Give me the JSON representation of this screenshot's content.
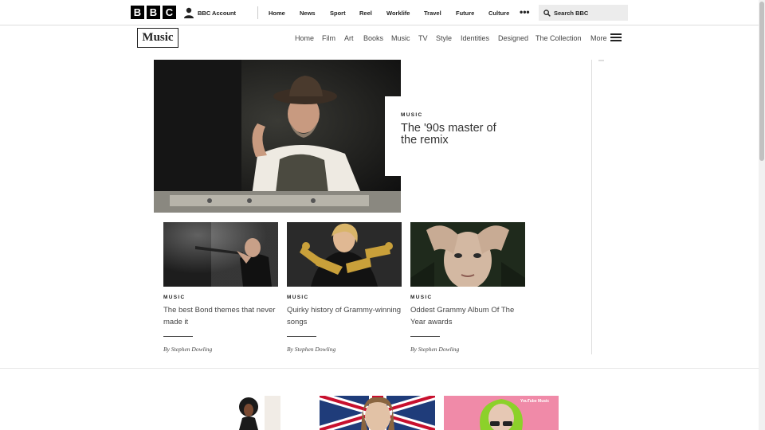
{
  "global_header": {
    "logo_letters": [
      "B",
      "B",
      "C"
    ],
    "account_label": "BBC Account",
    "nav": [
      "Home",
      "News",
      "Sport",
      "Reel",
      "Worklife",
      "Travel",
      "Future",
      "Culture"
    ],
    "more_label": "•••",
    "search_placeholder": "Search BBC"
  },
  "subnav": {
    "brand": "Music",
    "items": [
      "Home",
      "Film",
      "Art",
      "Books",
      "Music",
      "TV",
      "Style",
      "Identities",
      "Designed",
      "The Collection"
    ],
    "more_label": "More"
  },
  "hero": {
    "tag": "MUSIC",
    "title": "The '90s master of the remix"
  },
  "cards": [
    {
      "tag": "MUSIC",
      "title": "The best Bond themes that never made it",
      "byline": "By Stephen Dowling"
    },
    {
      "tag": "MUSIC",
      "title": "Quirky history of Grammy-winning songs",
      "byline": "By Stephen Dowling"
    },
    {
      "tag": "MUSIC",
      "title": "Oddest Grammy Album Of The Year awards",
      "byline": "By Stephen Dowling"
    }
  ],
  "colors": {
    "text": "#222222",
    "rule": "#dddddd",
    "search_bg": "#ececec"
  }
}
